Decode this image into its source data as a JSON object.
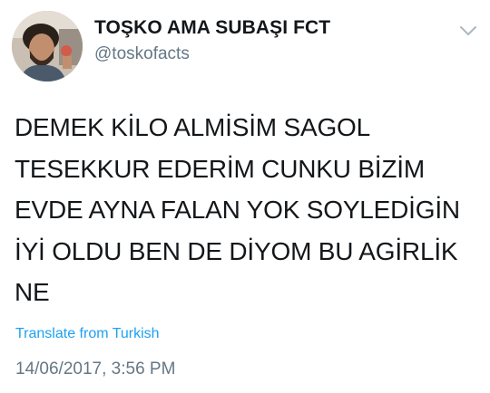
{
  "tweet": {
    "author": {
      "display_name": "TOŞKO AMA SUBAŞI FCT",
      "handle": "@toskofacts"
    },
    "text": "DEMEK KİLO ALMİSİM SAGOL\nTESEKKUR EDERİM CUNKU BİZİM\nEVDE AYNA FALAN YOK SOYLEDİGİN\nİYİ OLDU BEN DE DİYOM BU AGİRLİK\nNE",
    "translate_label": "Translate from Turkish",
    "timestamp": "14/06/2017, 3:56 PM",
    "menu_icon": "chevron-down-icon"
  },
  "colors": {
    "text": "#14171a",
    "secondary_text": "#657786",
    "link": "#1da1f2",
    "chevron": "#aab8c2"
  }
}
